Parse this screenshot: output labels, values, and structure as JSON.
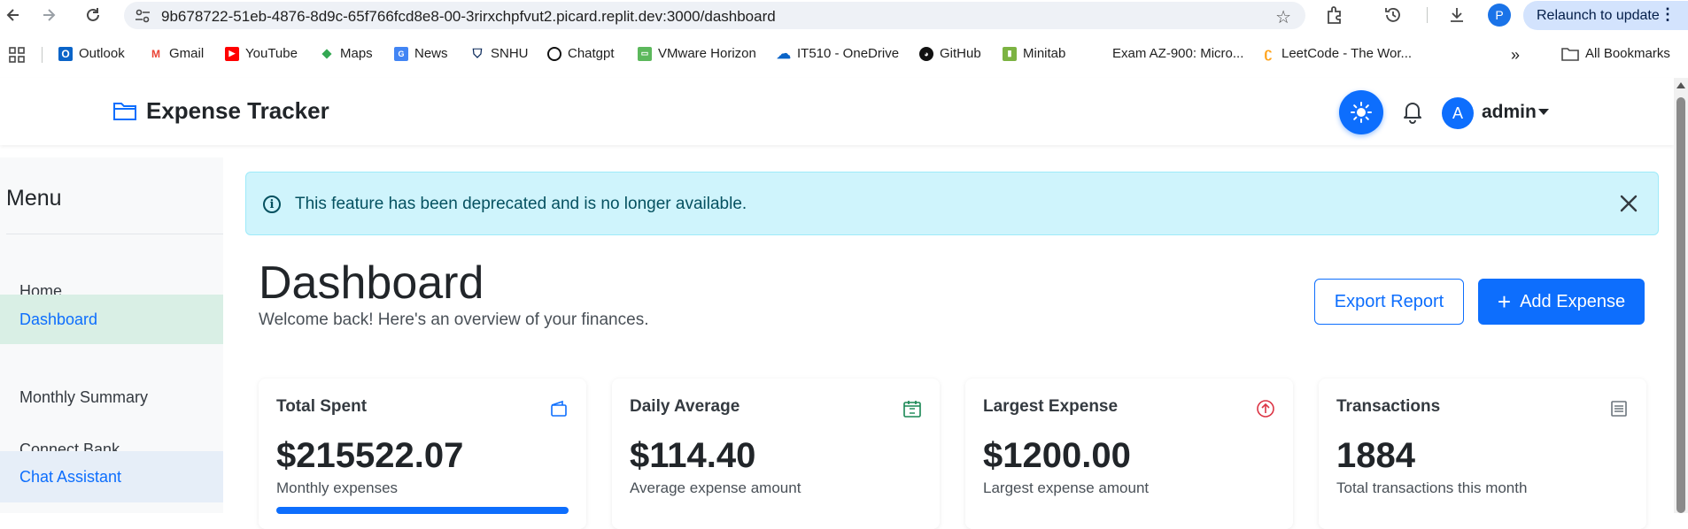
{
  "browser": {
    "url": "9b678722-51eb-4876-8d9c-65f766fcd8e8-00-3rirxchpfvut2.picard.replit.dev:3000/dashboard",
    "profile_initial": "P",
    "relaunch_label": "Relaunch to update",
    "bookmarks": [
      {
        "label": "Outlook",
        "icon": "outlook-icon",
        "color": "#0a64c8"
      },
      {
        "label": "Gmail",
        "icon": "gmail-icon",
        "color": "#ea4335"
      },
      {
        "label": "YouTube",
        "icon": "youtube-icon",
        "color": "#ff0000"
      },
      {
        "label": "Maps",
        "icon": "maps-icon",
        "color": "#34a853"
      },
      {
        "label": "News",
        "icon": "news-icon",
        "color": "#4285f4"
      },
      {
        "label": "SNHU",
        "icon": "snhu-icon",
        "color": "#0b2a5b"
      },
      {
        "label": "Chatgpt",
        "icon": "chatgpt-icon",
        "color": "#111111"
      },
      {
        "label": "VMware Horizon",
        "icon": "vmware-icon",
        "color": "#5cb85c"
      },
      {
        "label": "IT510 - OneDrive",
        "icon": "onedrive-icon",
        "color": "#0a64c8"
      },
      {
        "label": "GitHub",
        "icon": "github-icon",
        "color": "#111111"
      },
      {
        "label": "Minitab",
        "icon": "minitab-icon",
        "color": "#7cb342"
      },
      {
        "label": "Exam AZ-900: Micro...",
        "icon": "microsoft-icon",
        "color": "#f25022"
      },
      {
        "label": "LeetCode - The Wor...",
        "icon": "leetcode-icon",
        "color": "#ffa116"
      }
    ],
    "all_bookmarks_label": "All Bookmarks"
  },
  "header": {
    "brand": "Expense Tracker",
    "user_initial": "A",
    "user_name": "admin"
  },
  "sidebar": {
    "title": "Menu",
    "items": [
      {
        "label": "Home"
      },
      {
        "label": "Dashboard"
      },
      {
        "label": "Monthly Summary"
      },
      {
        "label": "Connect Bank"
      },
      {
        "label": "Chat Assistant"
      }
    ]
  },
  "alert": {
    "message": "This feature has been deprecated and is no longer available."
  },
  "page": {
    "title": "Dashboard",
    "subtitle": "Welcome back! Here's an overview of your finances.",
    "export_label": "Export Report",
    "add_label": "Add Expense"
  },
  "cards": [
    {
      "title": "Total Spent",
      "value": "$215522.07",
      "caption": "Monthly expenses",
      "icon": "wallet-icon",
      "icon_color": "#0d6efd"
    },
    {
      "title": "Daily Average",
      "value": "$114.40",
      "caption": "Average expense amount",
      "icon": "calendar-icon",
      "icon_color": "#198754"
    },
    {
      "title": "Largest Expense",
      "value": "$1200.00",
      "caption": "Largest expense amount",
      "icon": "arrow-up-circle-icon",
      "icon_color": "#dc3545"
    },
    {
      "title": "Transactions",
      "value": "1884",
      "caption": "Total transactions this month",
      "icon": "receipt-icon",
      "icon_color": "#6c757d"
    }
  ],
  "colors": {
    "primary": "#0d6efd",
    "alert_bg": "#cff4fc",
    "alert_text": "#055160",
    "active_menu_bg": "#d9efe5"
  }
}
